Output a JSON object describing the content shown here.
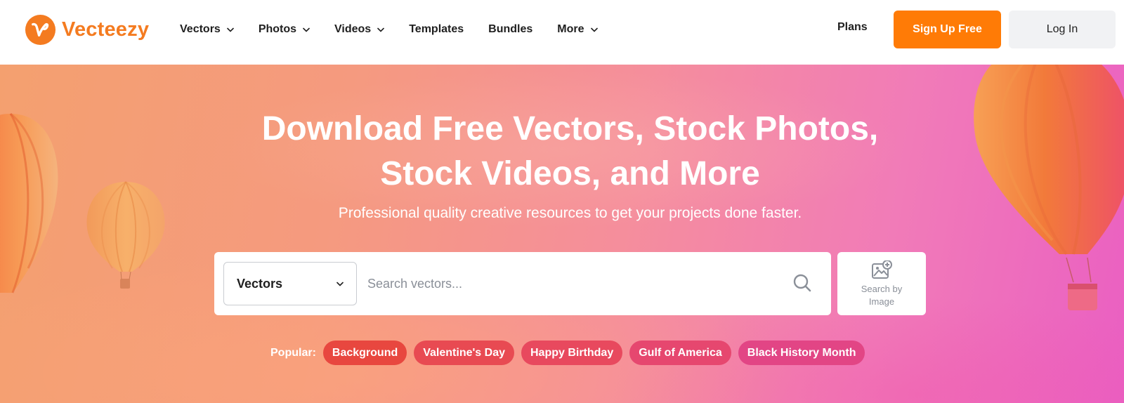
{
  "brand": {
    "name": "Vecteezy",
    "color": "#f47b20"
  },
  "nav": {
    "items": [
      {
        "label": "Vectors",
        "dropdown": true
      },
      {
        "label": "Photos",
        "dropdown": true
      },
      {
        "label": "Videos",
        "dropdown": true
      },
      {
        "label": "Templates",
        "dropdown": false
      },
      {
        "label": "Bundles",
        "dropdown": false
      },
      {
        "label": "More",
        "dropdown": true
      }
    ],
    "plans_label": "Plans",
    "signup_label": "Sign Up Free",
    "login_label": "Log In"
  },
  "hero": {
    "title_line1": "Download Free Vectors, Stock Photos,",
    "title_line2": "Stock Videos, and More",
    "subtitle": "Professional quality creative resources to get your projects done faster."
  },
  "search": {
    "asset_type": "Vectors",
    "placeholder": "Search vectors...",
    "search_by_image_label": "Search by Image"
  },
  "popular": {
    "label": "Popular:",
    "tags": [
      {
        "label": "Background",
        "color": "#e8473f"
      },
      {
        "label": "Valentine's Day",
        "color": "#e84a52"
      },
      {
        "label": "Happy Birthday",
        "color": "#e8495e"
      },
      {
        "label": "Gulf of America",
        "color": "#e6476f"
      },
      {
        "label": "Black History Month",
        "color": "#e24585"
      }
    ]
  },
  "colors": {
    "accent": "#ff7b06",
    "login_bg": "#f1f2f4"
  }
}
